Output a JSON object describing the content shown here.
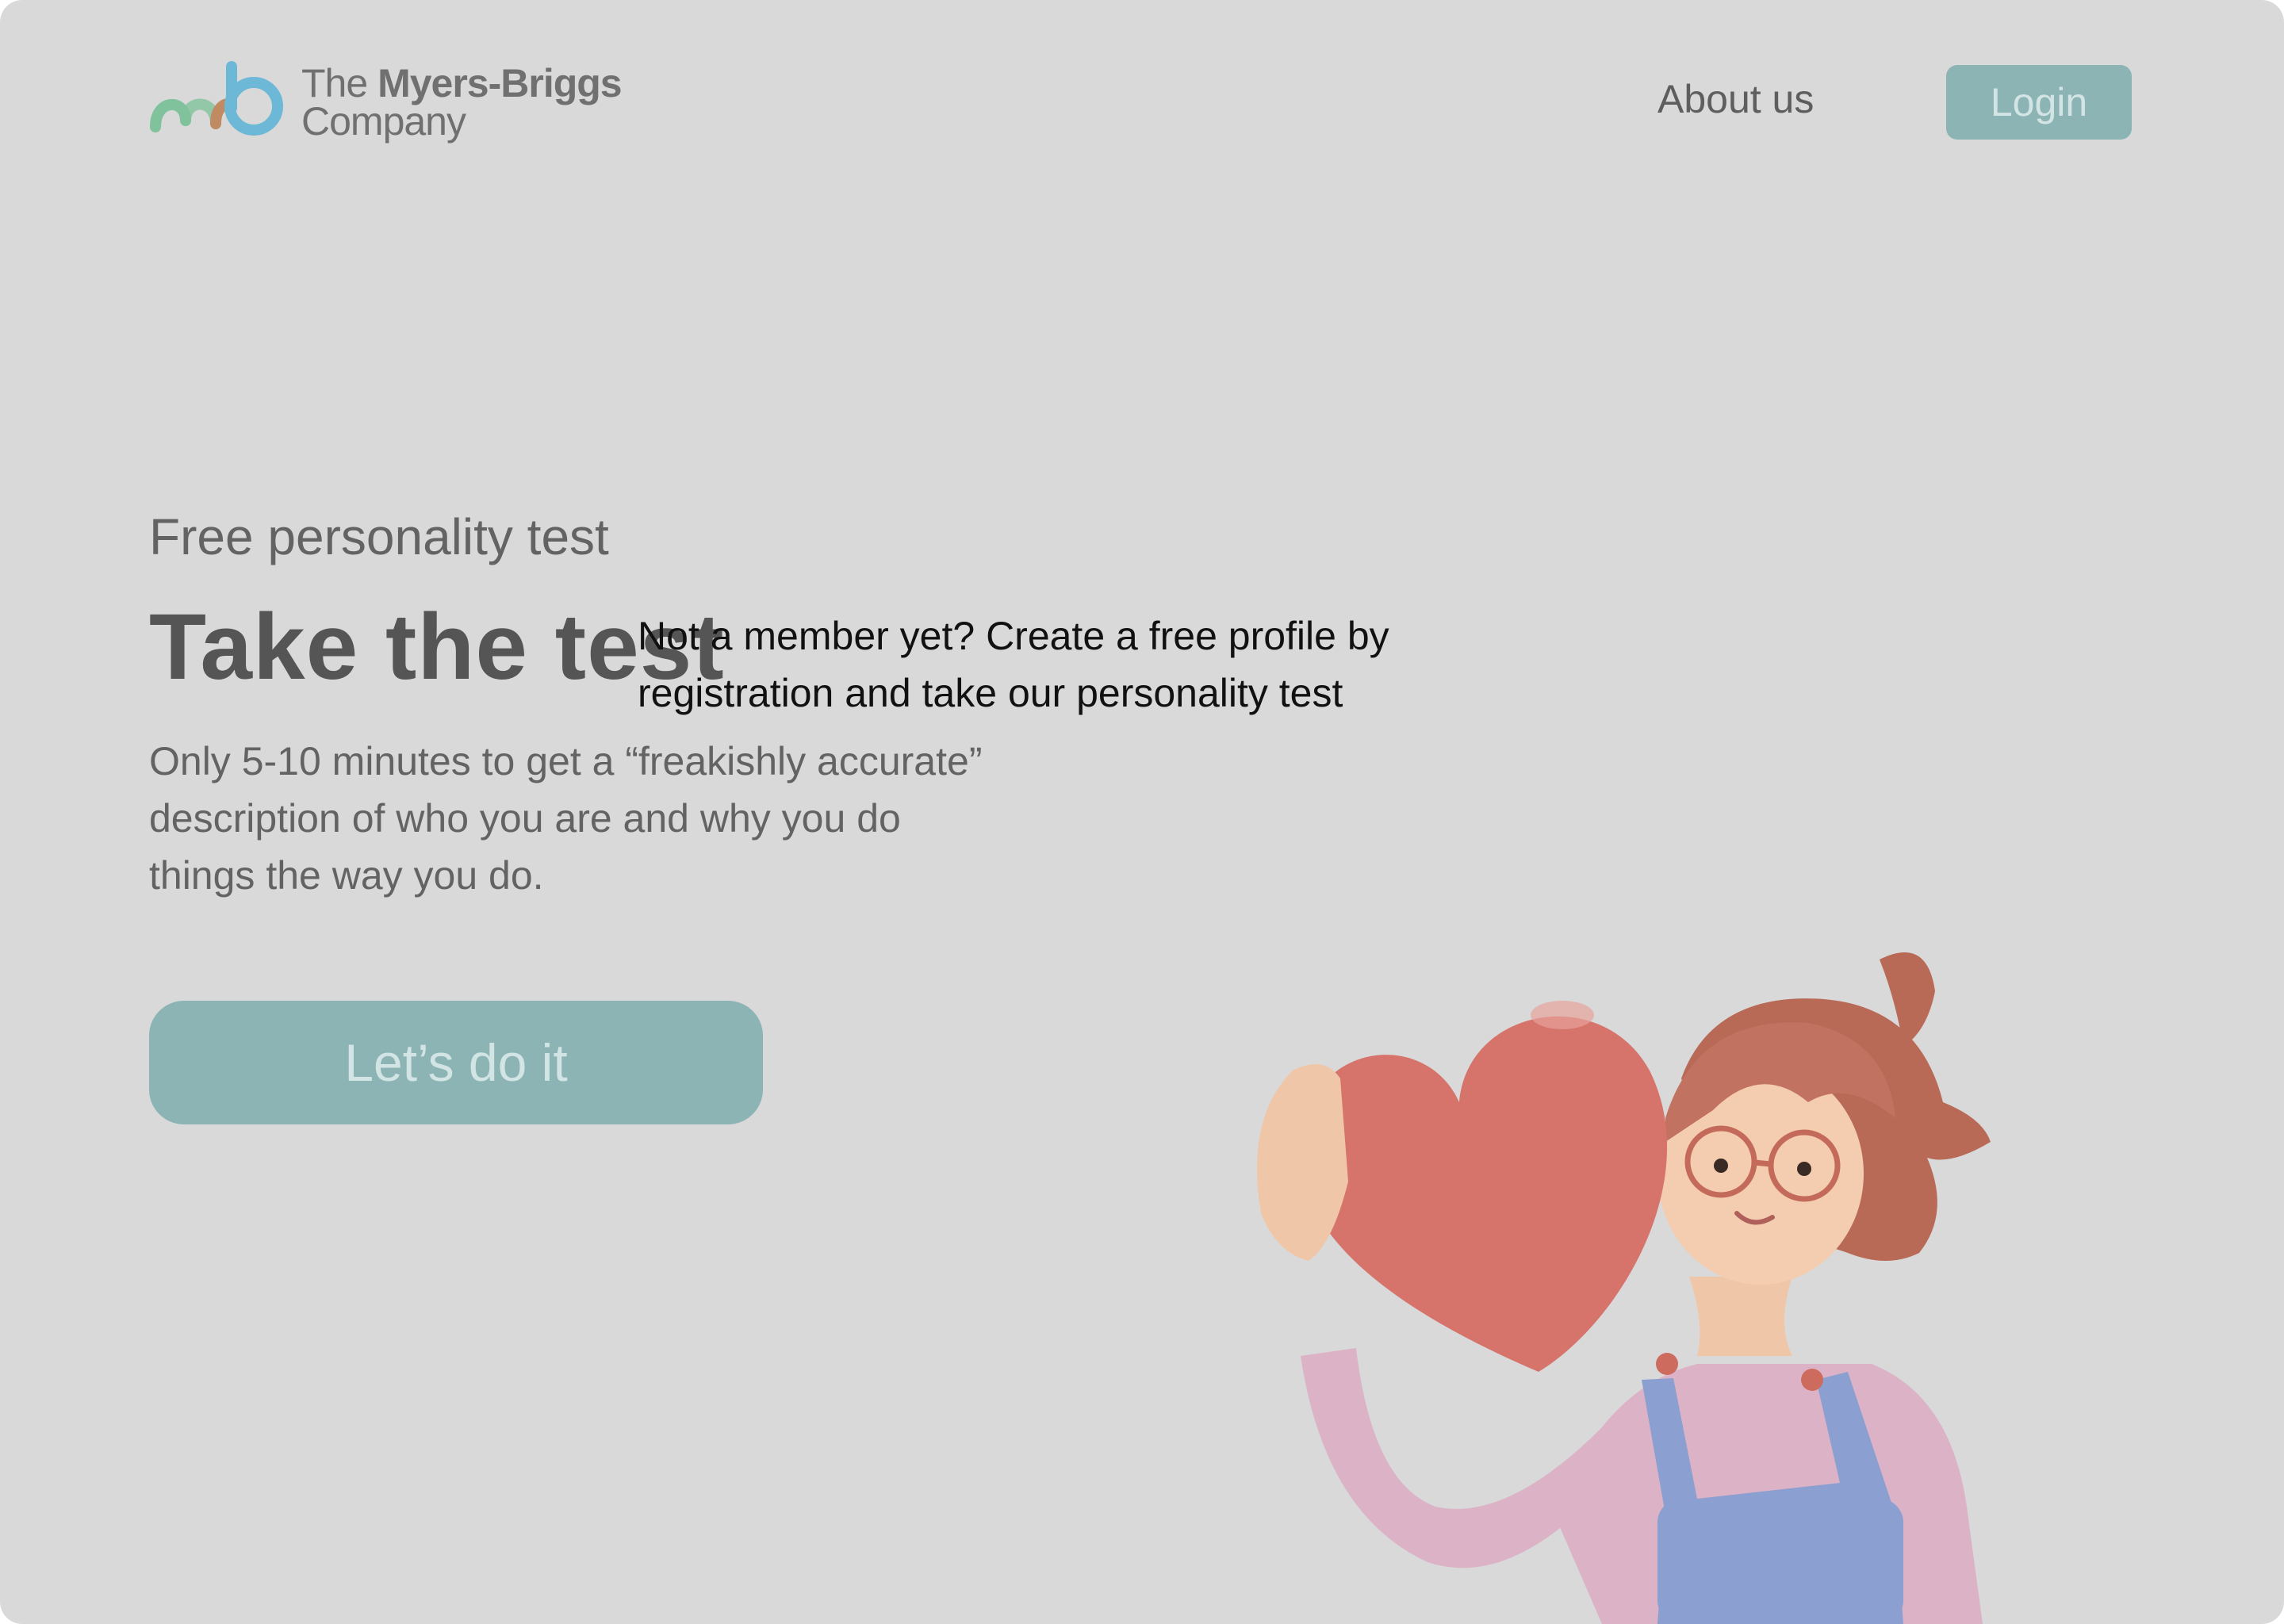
{
  "header": {
    "logo": {
      "line1_prefix": "The",
      "line1_brand": "Myers-Briggs",
      "line2": "Company",
      "icon": "mb-logo-icon"
    },
    "nav": {
      "about_label": "About us",
      "login_label": "Login"
    }
  },
  "hero": {
    "eyebrow": "Free personality test",
    "title": "Take the test",
    "description": "Only 5-10 minutes to get a “freakishly accurate”\ndescription of who you are and why you do\n things the way you do.",
    "cta_label": "Let’s do it"
  },
  "overlay": {
    "message": "Not a member yet? Create a free profile by registration and take our personality test"
  },
  "illustration": {
    "icon": "girl-holding-heart-illustration"
  },
  "colors": {
    "page_bg": "#d9d9d9",
    "accent": "#8cb4b4",
    "accent_text": "#d3e4e4",
    "heading_text": "#555555",
    "body_text": "#636363",
    "overlay_text": "#111111"
  }
}
